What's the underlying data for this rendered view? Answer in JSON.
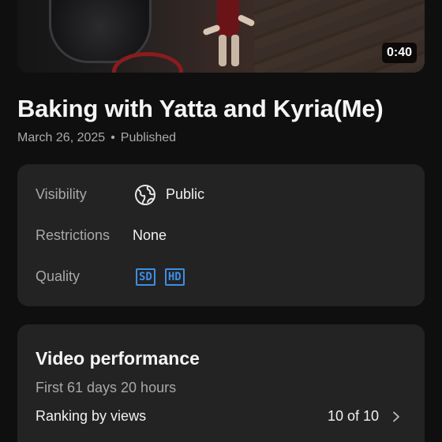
{
  "video": {
    "duration": "0:40",
    "title": "Baking with Yatta and Kyria(Me)",
    "date": "March 26, 2025",
    "separator": "•",
    "status": "Published"
  },
  "details": {
    "visibility_label": "Visibility",
    "visibility_value": "Public",
    "visibility_icon": "globe-icon",
    "restrictions_label": "Restrictions",
    "restrictions_value": "None",
    "quality_label": "Quality",
    "quality_badges": [
      "SD",
      "HD"
    ]
  },
  "performance": {
    "title": "Video performance",
    "period": "First 61 days 20 hours",
    "ranking_label": "Ranking by views",
    "ranking_value": "10 of 10"
  },
  "colors": {
    "background": "#0f0f0f",
    "card": "#232323",
    "badge_accent": "#3e8ee6",
    "muted_text": "#a8a8a8"
  }
}
